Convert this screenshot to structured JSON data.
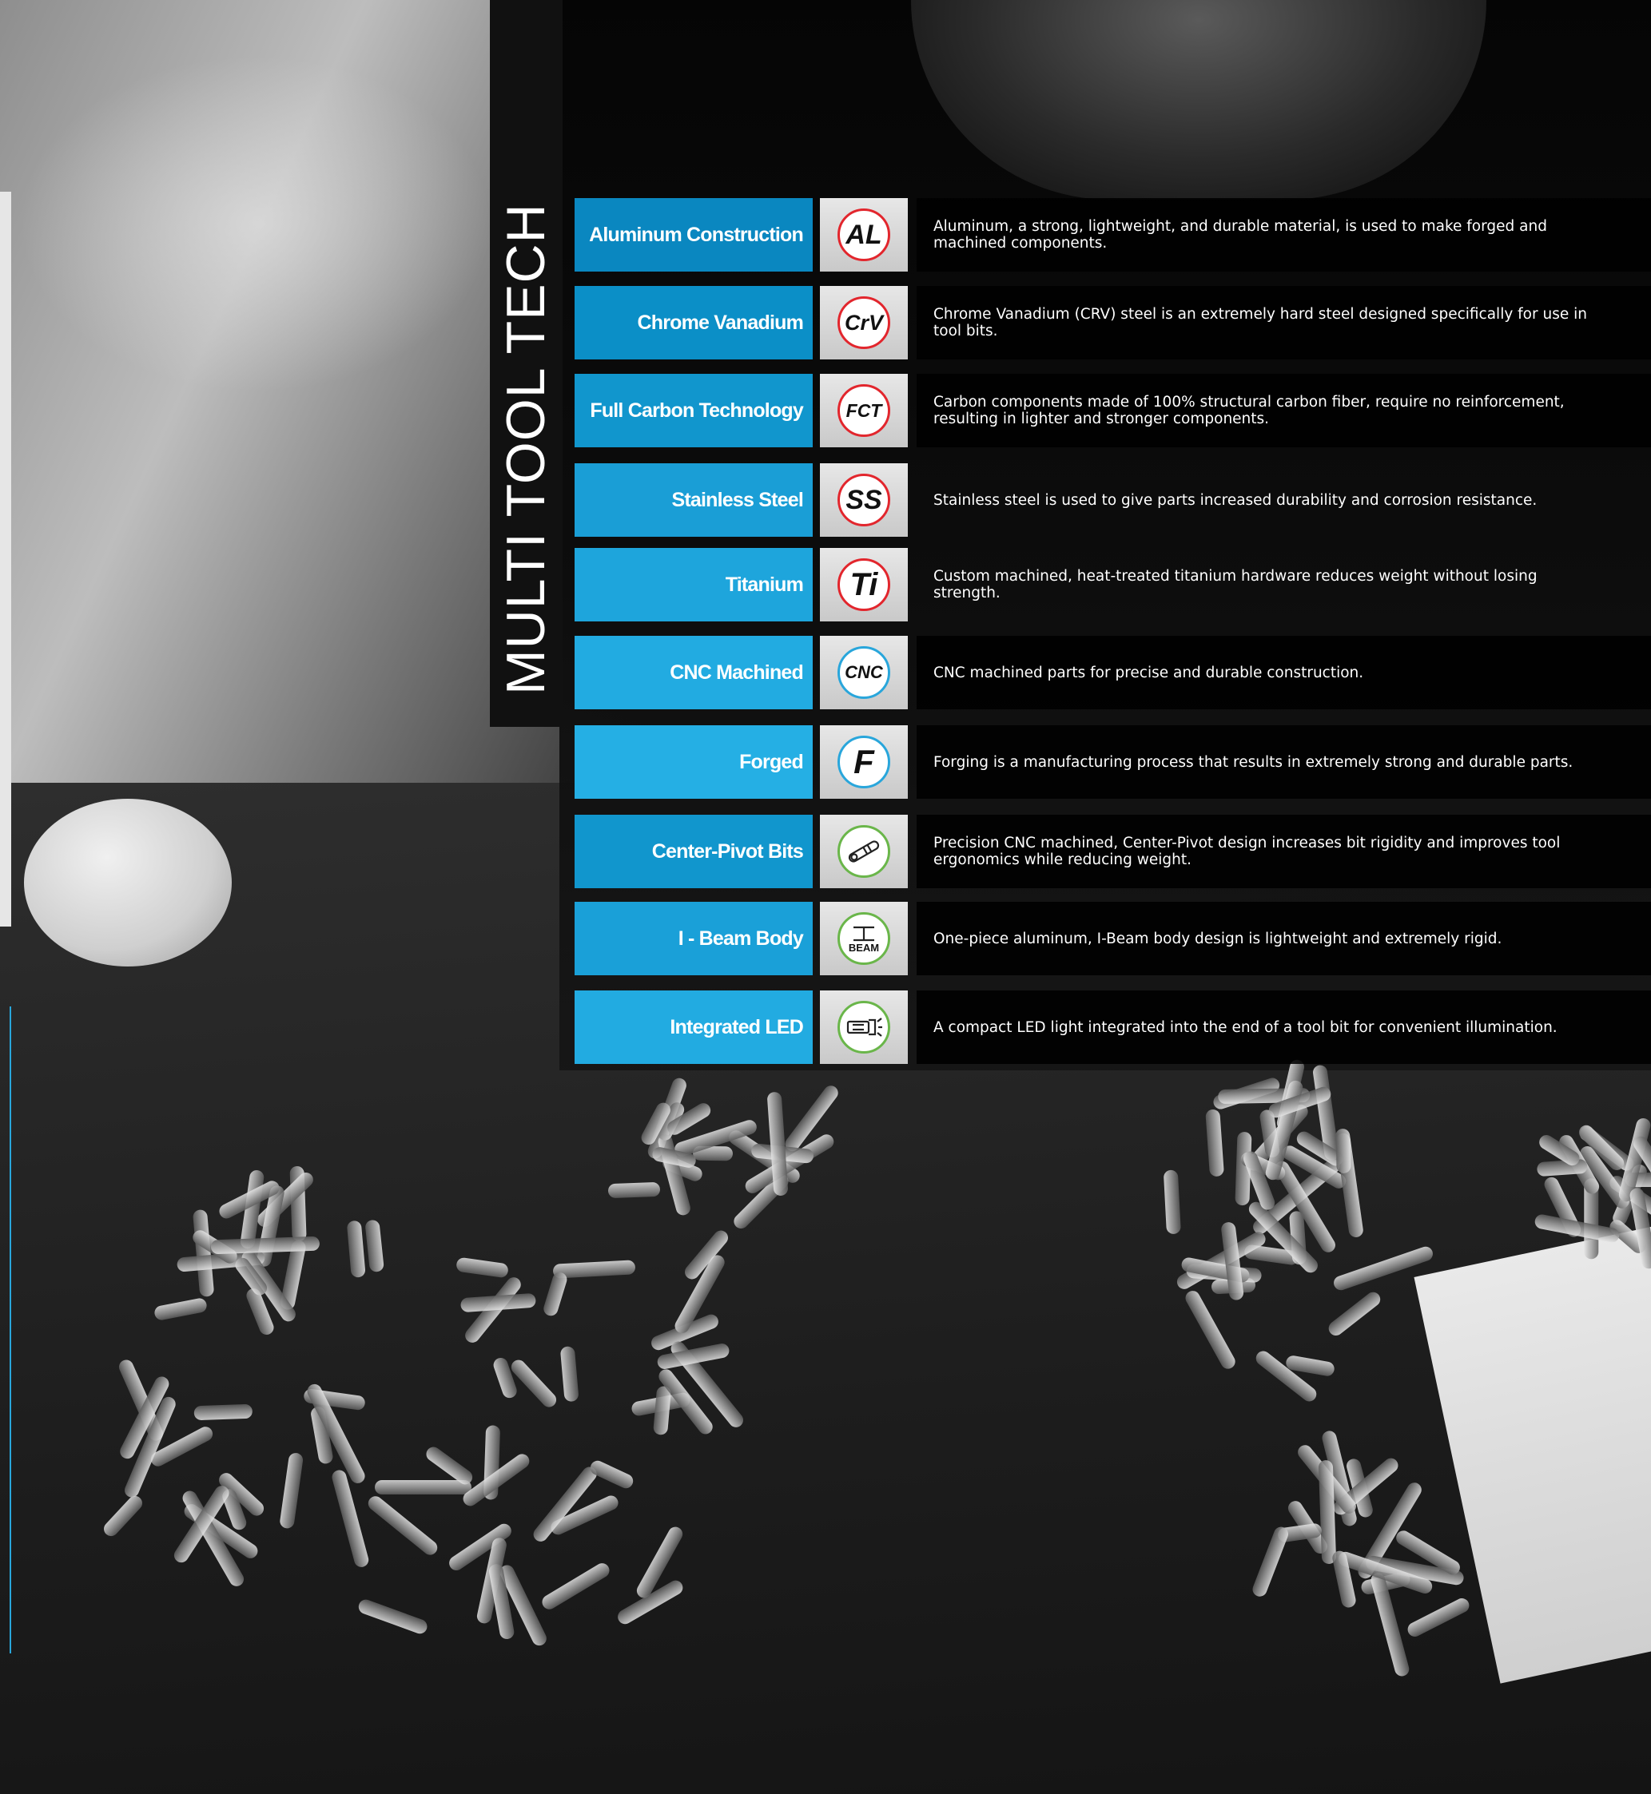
{
  "heading": "MULTI TOOL TECH",
  "colors": {
    "blue_dark": "#0a87c0",
    "blue_mid": "#1a9ed6",
    "blue_light": "#29b5e8",
    "badge_red": "#e2262d",
    "badge_blue": "#29a6db",
    "badge_green": "#6ab64a"
  },
  "features": [
    {
      "label": "Aluminum Construction",
      "badge_text": "AL",
      "badge_color": "red",
      "icon": "al-badge-icon",
      "description": "Aluminum, a strong, lightweight, and durable material, is used to make forged and machined components."
    },
    {
      "label": "Chrome Vanadium",
      "badge_text": "CrV",
      "badge_color": "red",
      "icon": "crv-badge-icon",
      "description": "Chrome Vanadium (CRV) steel is an extremely hard steel designed specifically for use in tool bits."
    },
    {
      "label": "Full Carbon Technology",
      "badge_text": "FCT",
      "badge_color": "red",
      "icon": "fct-badge-icon",
      "description": "Carbon components made of 100% structural carbon fiber, require no reinforcement, resulting in lighter and stronger components."
    },
    {
      "label": "Stainless Steel",
      "badge_text": "SS",
      "badge_color": "red",
      "icon": "ss-badge-icon",
      "description": "Stainless steel is used to give parts increased durability and corrosion resistance."
    },
    {
      "label": "Titanium",
      "badge_text": "Ti",
      "badge_color": "red",
      "icon": "ti-badge-icon",
      "description": "Custom machined, heat-treated titanium hardware reduces weight without losing strength."
    },
    {
      "label": "CNC Machined",
      "badge_text": "CNC",
      "badge_color": "blue",
      "icon": "cnc-badge-icon",
      "description": "CNC machined parts for precise and durable construction."
    },
    {
      "label": "Forged",
      "badge_text": "F",
      "badge_color": "blue",
      "icon": "forged-badge-icon",
      "description": "Forging is a manufacturing process that results in extremely strong and durable parts."
    },
    {
      "label": "Center-Pivot Bits",
      "badge_text": "",
      "badge_color": "green",
      "icon": "center-pivot-bit-icon",
      "description": "Precision CNC machined, Center-Pivot design increases bit rigidity and improves tool ergonomics while reducing weight."
    },
    {
      "label": "I - Beam Body",
      "badge_text": "BEAM",
      "badge_color": "green",
      "icon": "i-beam-icon",
      "description": "One-piece aluminum, I-Beam body design is lightweight and extremely rigid."
    },
    {
      "label": "Integrated LED",
      "badge_text": "",
      "badge_color": "green",
      "icon": "led-flashlight-icon",
      "description": "A compact LED light integrated into the end of a tool bit for convenient illumination."
    }
  ]
}
